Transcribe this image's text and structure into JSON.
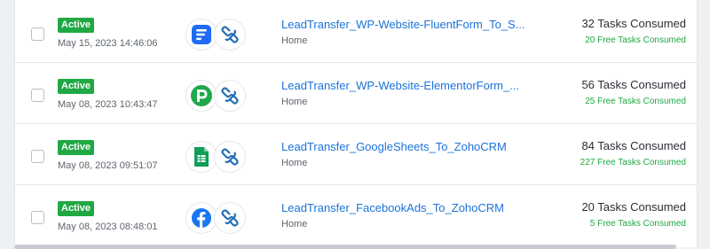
{
  "rows": [
    {
      "status": "Active",
      "date": "May 15, 2023 14:46:06",
      "app_icon": "fluentforms-icon",
      "name": "LeadTransfer_WP-Website-FluentForm_To_S...",
      "folder": "Home",
      "tasks": "32 Tasks Consumed",
      "free": "20 Free Tasks Consumed"
    },
    {
      "status": "Active",
      "date": "May 08, 2023 10:43:47",
      "app_icon": "pabbly-icon",
      "name": "LeadTransfer_WP-Website-ElementorForm_...",
      "folder": "Home",
      "tasks": "56 Tasks Consumed",
      "free": "25 Free Tasks Consumed"
    },
    {
      "status": "Active",
      "date": "May 08, 2023 09:51:07",
      "app_icon": "google-sheets-icon",
      "name": "LeadTransfer_GoogleSheets_To_ZohoCRM",
      "folder": "Home",
      "tasks": "84 Tasks Consumed",
      "free": "227 Free Tasks Consumed"
    },
    {
      "status": "Active",
      "date": "May 08, 2023 08:48:01",
      "app_icon": "facebook-icon",
      "name": "LeadTransfer_FacebookAds_To_ZohoCRM",
      "folder": "Home",
      "tasks": "20 Tasks Consumed",
      "free": "5 Free Tasks Consumed"
    }
  ],
  "colors": {
    "active_badge": "#1fa843",
    "link": "#1a73d9",
    "free_tasks": "#1fa843",
    "zoho_blue": "#226db4"
  }
}
